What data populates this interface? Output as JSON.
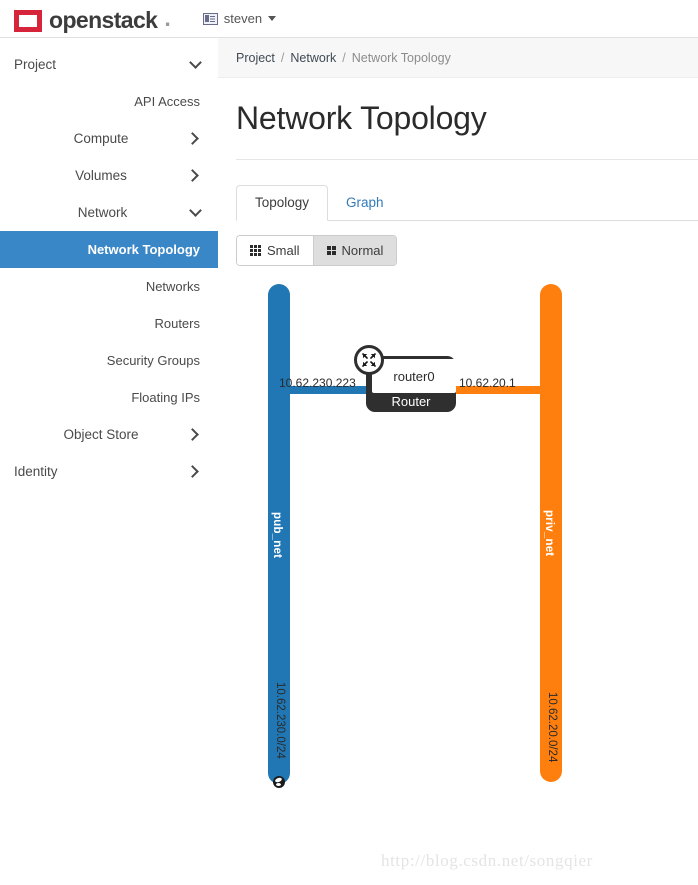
{
  "navbar": {
    "brand_name": "openstack",
    "brand_dot": ".",
    "user_name": "steven",
    "user_icon": "card-icon",
    "caret_icon": "chevron-down-icon"
  },
  "sidebar": {
    "items": [
      {
        "label": "Project",
        "type": "group",
        "chevron": "chevron-down-icon",
        "align": "right",
        "active": false
      },
      {
        "label": "API Access",
        "type": "sub",
        "chevron": "",
        "align": "right",
        "active": false
      },
      {
        "label": "Compute",
        "type": "group",
        "chevron": "chevron-right-icon",
        "align": "right",
        "active": false
      },
      {
        "label": "Volumes",
        "type": "group",
        "chevron": "chevron-right-icon",
        "align": "right",
        "active": false
      },
      {
        "label": "Network",
        "type": "group",
        "chevron": "chevron-down-icon",
        "align": "right",
        "active": false
      },
      {
        "label": "Network Topology",
        "type": "sub",
        "chevron": "",
        "align": "right",
        "active": true
      },
      {
        "label": "Networks",
        "type": "sub",
        "chevron": "",
        "align": "right",
        "active": false
      },
      {
        "label": "Routers",
        "type": "sub",
        "chevron": "",
        "align": "right",
        "active": false
      },
      {
        "label": "Security Groups",
        "type": "sub",
        "chevron": "",
        "align": "right",
        "active": false
      },
      {
        "label": "Floating IPs",
        "type": "sub",
        "chevron": "",
        "align": "right",
        "active": false
      },
      {
        "label": "Object Store",
        "type": "group",
        "chevron": "chevron-right-icon",
        "align": "right",
        "active": false
      },
      {
        "label": "Identity",
        "type": "group",
        "chevron": "chevron-right-icon",
        "align": "left",
        "active": false
      }
    ],
    "active_color": "#3a87c8"
  },
  "breadcrumb": {
    "items": [
      "Project",
      "Network",
      "Network Topology"
    ],
    "separator": "/",
    "item0": "Project",
    "sep0": "/",
    "item1": "Network",
    "sep1": "/",
    "current": "Network Topology"
  },
  "page": {
    "title": "Network Topology"
  },
  "tabs": {
    "active": "Topology",
    "items": [
      {
        "label": "Topology",
        "active": true
      },
      {
        "label": "Graph",
        "active": false
      }
    ],
    "topology_label": "Topology",
    "graph_label": "Graph"
  },
  "size_toggle": {
    "selected": "Normal",
    "small_label": "Small",
    "normal_label": "Normal",
    "small_icon": "grid-3x3-icon",
    "normal_icon": "grid-2x2-icon"
  },
  "topology": {
    "networks": [
      {
        "name": "pub_net",
        "subnet": "10.62.230.0/24",
        "color": "#2077b4",
        "external": true,
        "external_icon": "globe-icon"
      },
      {
        "name": "priv_net",
        "subnet": "10.62.20.0/24",
        "color": "#ff7f0e",
        "external": false
      }
    ],
    "pub_name": "pub_net",
    "pub_subnet": "10.62.230.0/24",
    "priv_name": "priv_net",
    "priv_subnet": "10.62.20.0/24",
    "router": {
      "name": "router0",
      "type_label": "Router",
      "icon": "router-icon",
      "left_ip": "10.62.230.223",
      "right_ip": "10.62.20.1"
    }
  },
  "watermark": {
    "text": "http://blog.csdn.net/songqier"
  }
}
